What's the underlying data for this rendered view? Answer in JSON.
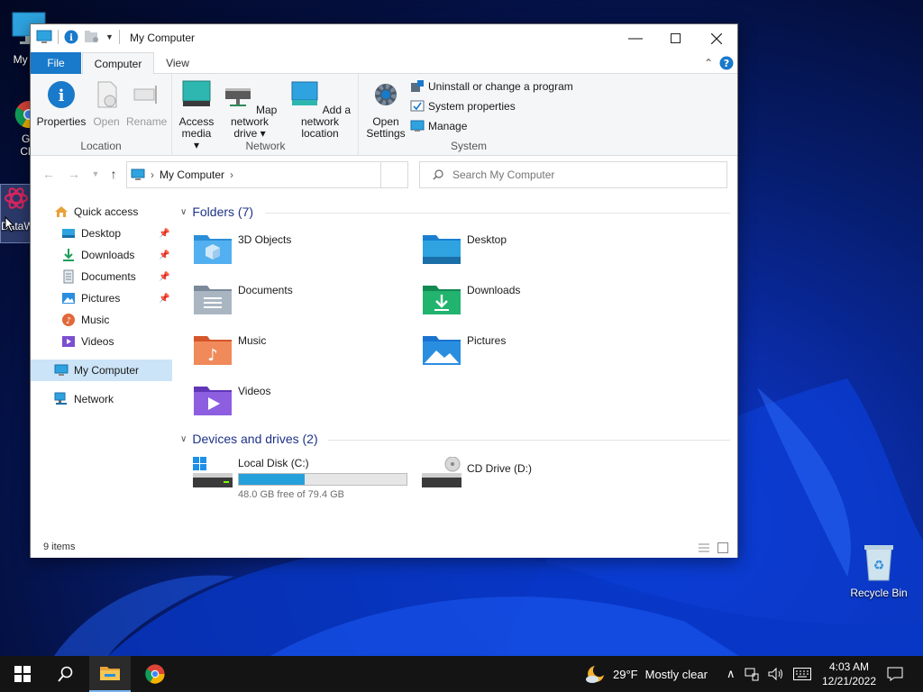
{
  "desktop": {
    "icons": [
      {
        "label": "My Co"
      },
      {
        "label": "Go Chr"
      },
      {
        "label": "DataW"
      },
      {
        "label": "Recycle Bin"
      }
    ]
  },
  "window": {
    "title": "My Computer",
    "tabs": {
      "file": "File",
      "computer": "Computer",
      "view": "View"
    },
    "ribbon": {
      "location": {
        "title": "Location",
        "properties": "Properties",
        "open": "Open",
        "rename": "Rename"
      },
      "network": {
        "title": "Network",
        "access_media": "Access media ▾",
        "map_drive_1": "Map network",
        "map_drive_2": "drive ▾",
        "add_location_1": "Add a network",
        "add_location_2": "location"
      },
      "system": {
        "title": "System",
        "open_settings_1": "Open",
        "open_settings_2": "Settings",
        "uninstall": "Uninstall or change a program",
        "system_properties": "System properties",
        "manage": "Manage"
      }
    },
    "address": {
      "path": "My Computer",
      "separator": "›"
    },
    "search": {
      "placeholder": "Search My Computer"
    },
    "sidebar": {
      "quick_access": "Quick access",
      "items": [
        {
          "label": "Desktop",
          "pinned": true
        },
        {
          "label": "Downloads",
          "pinned": true
        },
        {
          "label": "Documents",
          "pinned": true
        },
        {
          "label": "Pictures",
          "pinned": true
        },
        {
          "label": "Music",
          "pinned": false
        },
        {
          "label": "Videos",
          "pinned": false
        }
      ],
      "my_computer": "My Computer",
      "network": "Network"
    },
    "folders": {
      "header": "Folders (7)",
      "items": [
        {
          "label": "3D Objects"
        },
        {
          "label": "Desktop"
        },
        {
          "label": "Documents"
        },
        {
          "label": "Downloads"
        },
        {
          "label": "Music"
        },
        {
          "label": "Pictures"
        },
        {
          "label": "Videos"
        }
      ]
    },
    "devices": {
      "header": "Devices and drives (2)",
      "local_disk": {
        "label": "Local Disk (C:)",
        "free_text": "48.0 GB free of 79.4 GB",
        "used_fraction": 0.395
      },
      "cd_drive": {
        "label": "CD Drive (D:)"
      }
    },
    "status": {
      "items": "9 items"
    }
  },
  "taskbar": {
    "weather_temp": "29°F",
    "weather_text": "Mostly clear",
    "time": "4:03 AM",
    "date": "12/21/2022"
  },
  "colors": {
    "accent": "#1979ca",
    "selection": "#cce4f7",
    "progress": "#26a0da",
    "header": "#1e3287"
  }
}
